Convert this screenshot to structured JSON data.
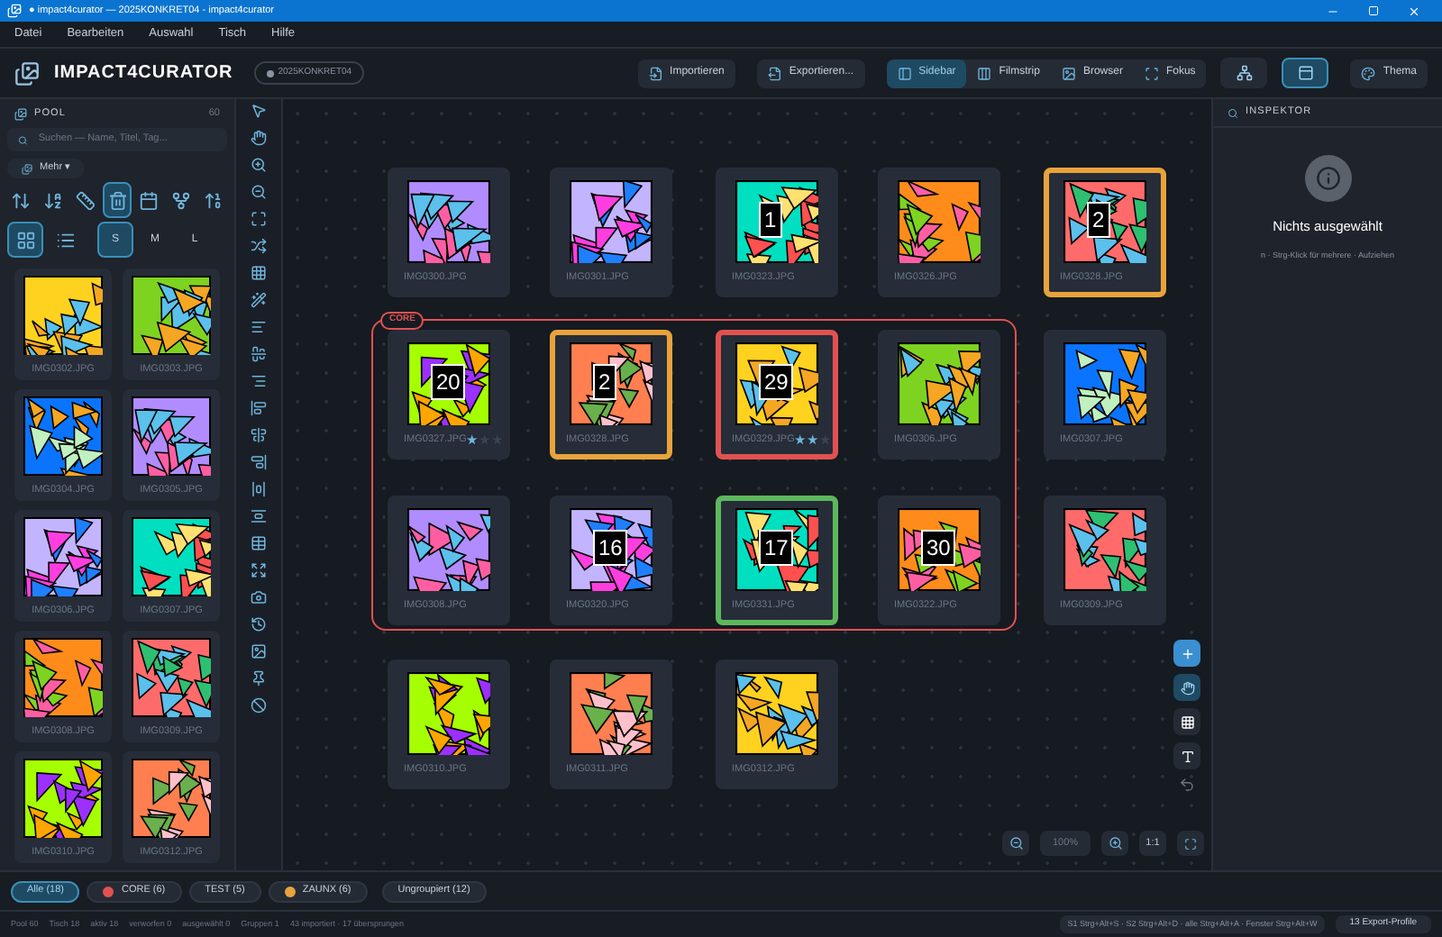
{
  "window": {
    "title": "● impact4curator — 2025KONKRET04 - impact4curator"
  },
  "menu": [
    "Datei",
    "Bearbeiten",
    "Auswahl",
    "Tisch",
    "Hilfe"
  ],
  "header": {
    "app_name": "IMPACT4CURATOR",
    "project": "2025KONKRET04",
    "import": "Importieren",
    "export": "Exportieren...",
    "view_modes": [
      {
        "label": "Sidebar",
        "selected": true
      },
      {
        "label": "Filmstrip",
        "selected": false
      },
      {
        "label": "Browser",
        "selected": false
      },
      {
        "label": "Fokus",
        "selected": false
      }
    ],
    "layout_toggles": [
      {
        "selected": false
      },
      {
        "selected": true
      }
    ],
    "theme": "Thema"
  },
  "pool": {
    "title": "POOL",
    "count": "60",
    "search_placeholder": "Suchen — Name, Titel, Tag...",
    "more": "Mehr ▾",
    "sort_buttons": [
      {
        "selected": false
      },
      {
        "selected": false
      },
      {
        "selected": false
      },
      {
        "selected": true
      },
      {
        "selected": false
      },
      {
        "selected": false
      },
      {
        "selected": false
      }
    ],
    "view_buttons": [
      {
        "selected": true
      },
      {
        "selected": false
      }
    ],
    "sizes": [
      {
        "label": "S",
        "selected": true
      },
      {
        "label": "M",
        "selected": false
      },
      {
        "label": "L",
        "selected": false
      }
    ],
    "thumbnails": [
      "IMG0302.JPG",
      "IMG0303.JPG",
      "IMG0304.JPG",
      "IMG0305.JPG",
      "IMG0306.JPG",
      "IMG0307.JPG",
      "IMG0308.JPG",
      "IMG0309.JPG",
      "IMG0310.JPG",
      "IMG0312.JPG"
    ]
  },
  "canvas": {
    "groups": [
      {
        "label": "CORE",
        "color": "#e05252"
      }
    ],
    "tiles": [
      {
        "name": "IMG0300.JPG"
      },
      {
        "name": "IMG0301.JPG"
      },
      {
        "name": "IMG0323.JPG",
        "badge": "1"
      },
      {
        "name": "IMG0326.JPG"
      },
      {
        "name": "IMG0328.JPG",
        "badge": "2",
        "color": "#e8a33c"
      },
      {
        "name": "IMG0327.JPG",
        "badge": "20",
        "stars": 1
      },
      {
        "name": "IMG0328.JPG",
        "badge": "2",
        "color": "#e8a33c"
      },
      {
        "name": "IMG0329.JPG",
        "badge": "29",
        "stars": 2,
        "color": "#e05252"
      },
      {
        "name": "IMG0306.JPG"
      },
      {
        "name": "IMG0307.JPG"
      },
      {
        "name": "IMG0308.JPG"
      },
      {
        "name": "IMG0320.JPG",
        "badge": "16"
      },
      {
        "name": "IMG0331.JPG",
        "badge": "17",
        "color": "#5cb85c"
      },
      {
        "name": "IMG0322.JPG",
        "badge": "30"
      },
      {
        "name": "IMG0309.JPG"
      },
      {
        "name": "IMG0310.JPG"
      },
      {
        "name": "IMG0311.JPG"
      },
      {
        "name": "IMG0312.JPG"
      }
    ],
    "zoom": "100%",
    "one_to_one": "1:1"
  },
  "inspector": {
    "title": "INSPEKTOR",
    "empty": "Nichts ausgewählt",
    "hint": "n · Strg-Klick für mehrere · Aufziehen"
  },
  "group_tabs": [
    {
      "label": "Alle (18)",
      "selected": true
    },
    {
      "label": "CORE (6)",
      "color": "#e05252",
      "selected": false
    },
    {
      "label": "TEST (5)",
      "selected": false
    },
    {
      "label": "ZAUNX (6)",
      "color": "#e8a33c",
      "selected": false
    },
    {
      "label": "Ungroupiert (12)",
      "selected": false
    }
  ],
  "status": {
    "items": [
      "Pool 60",
      "Tisch 18",
      "aktiv 18",
      "verworfen 0",
      "ausgewählt 0",
      "Gruppen 1",
      "43 importiert · 17 übersprungen"
    ],
    "shortcuts": "S1 Strg+Alt+S · S2 Strg+Alt+D · alle Strg+Alt+A · Fenster Strg+Alt+W",
    "export_profiles": "13 Export-Profile"
  }
}
